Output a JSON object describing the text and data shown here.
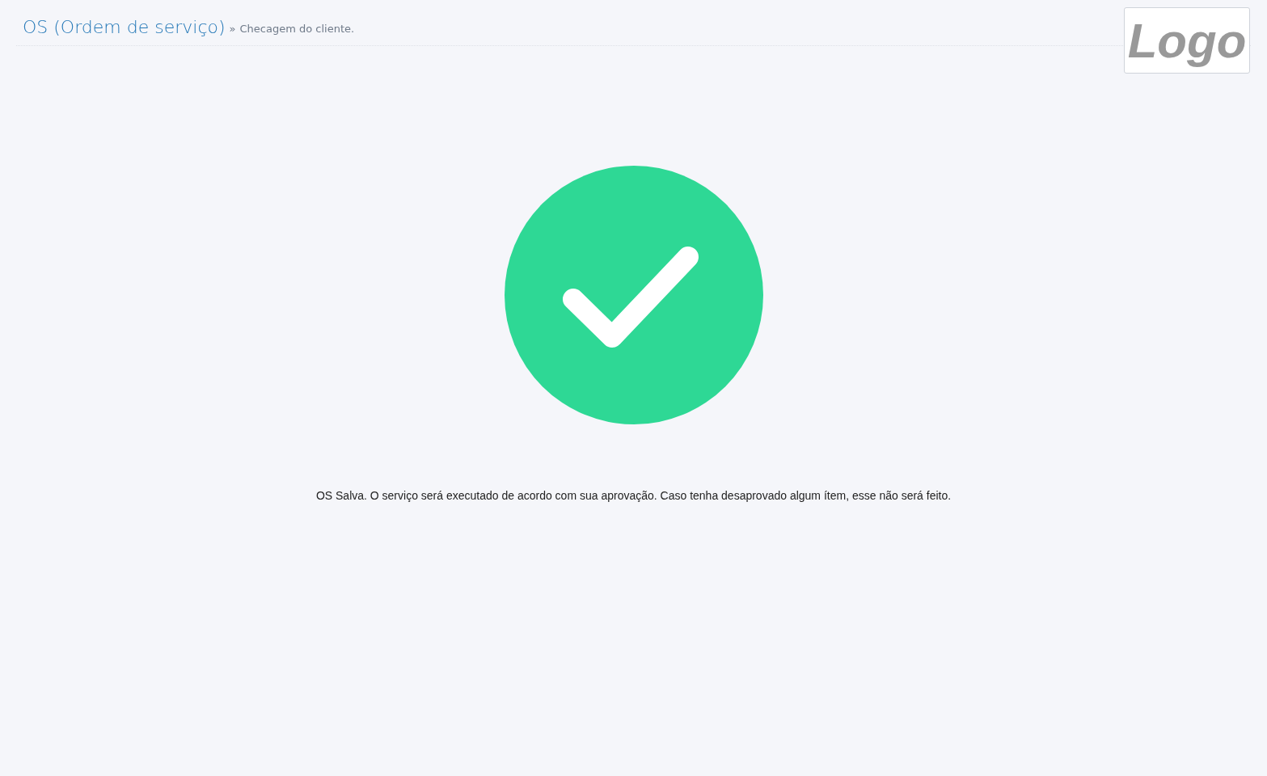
{
  "header": {
    "title": "OS (Ordem de serviço)",
    "separator": "»",
    "subtitle": "Checagem do cliente."
  },
  "logo": {
    "text": "Logo"
  },
  "message": "OS Salva. O serviço será executado de acordo com sua aprovação. Caso tenha desaprovado algum ítem, esse não será feito."
}
